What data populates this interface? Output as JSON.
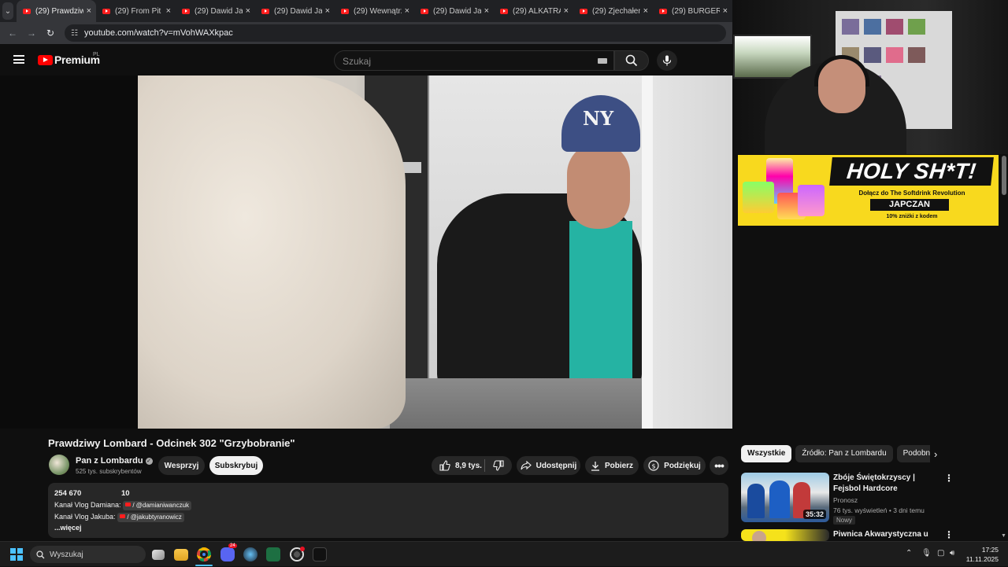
{
  "browser": {
    "tabs": [
      {
        "label": "(29) Prawdziwy",
        "active": true
      },
      {
        "label": "(29) From Pit L",
        "active": false
      },
      {
        "label": "(29) Dawid Jas",
        "active": false
      },
      {
        "label": "(29) Dawid Jas",
        "active": false
      },
      {
        "label": "(29) Wewnątrz",
        "active": false
      },
      {
        "label": "(29) Dawid Jas",
        "active": false
      },
      {
        "label": "(29) ALKATRAZ",
        "active": false
      },
      {
        "label": "(29) Zjechałem",
        "active": false
      },
      {
        "label": "(29) BURGER K",
        "active": false
      }
    ],
    "tab_close_glyph": "×",
    "url": "youtube.com/watch?v=mVohWAXkpac"
  },
  "youtube": {
    "logo_text": "Premium",
    "logo_region": "PL",
    "search_placeholder": "Szukaj"
  },
  "video": {
    "cap_text": "NY",
    "title": "Prawdziwy Lombard - Odcinek 302 \"Grzybobranie\"",
    "channel": {
      "name": "Pan z Lombardu",
      "subscribers": "525 tys. subskrybentów"
    },
    "buttons": {
      "join": "Wesprzyj",
      "subscribe": "Subskrybuj",
      "likes": "8,9 tys.",
      "share": "Udostępnij",
      "download": "Pobierz",
      "thanks": "Podziękuj"
    },
    "description": {
      "views": "254 670",
      "comments_count": "10",
      "line1_prefix": "Kanał Vlog Damiana:",
      "line1_handle": "/ @damianiwanczuk",
      "line2_prefix": "Kanał Vlog Jakuba:",
      "line2_handle": "/ @jakubtyranowicz",
      "more": "...więcej"
    }
  },
  "ad": {
    "title": "HOLY SH*T!",
    "subtitle": "Dołącz do The Softdrink Revolution",
    "code": "JAPCZAN",
    "discount": "10% zniżki z kodem"
  },
  "sidebar": {
    "chips": [
      "Wszystkie",
      "Źródło: Pan z Lombardu",
      "Podobne"
    ],
    "recommendations": [
      {
        "title": "Zbóje Świętokrzyscy | Fejsbol Hardcore",
        "channel": "Pronosz",
        "meta": "76 tys. wyświetleń • 3 dni temu",
        "badge": "Nowy",
        "duration": "35:32"
      },
      {
        "title": "Piwnica Akwarystyczna u",
        "channel": "",
        "meta": "",
        "badge": "",
        "duration": ""
      }
    ]
  },
  "taskbar": {
    "search_placeholder": "Wyszukaj",
    "time": "17:25",
    "date": "11.11.2025",
    "discord_badge": "24"
  },
  "colors": {
    "yt_red": "#ff0000",
    "background": "#0f0f0f",
    "pill_bg": "#272727",
    "ad_yellow": "#f8d91e",
    "windows_blue": "#4cc2ff"
  }
}
